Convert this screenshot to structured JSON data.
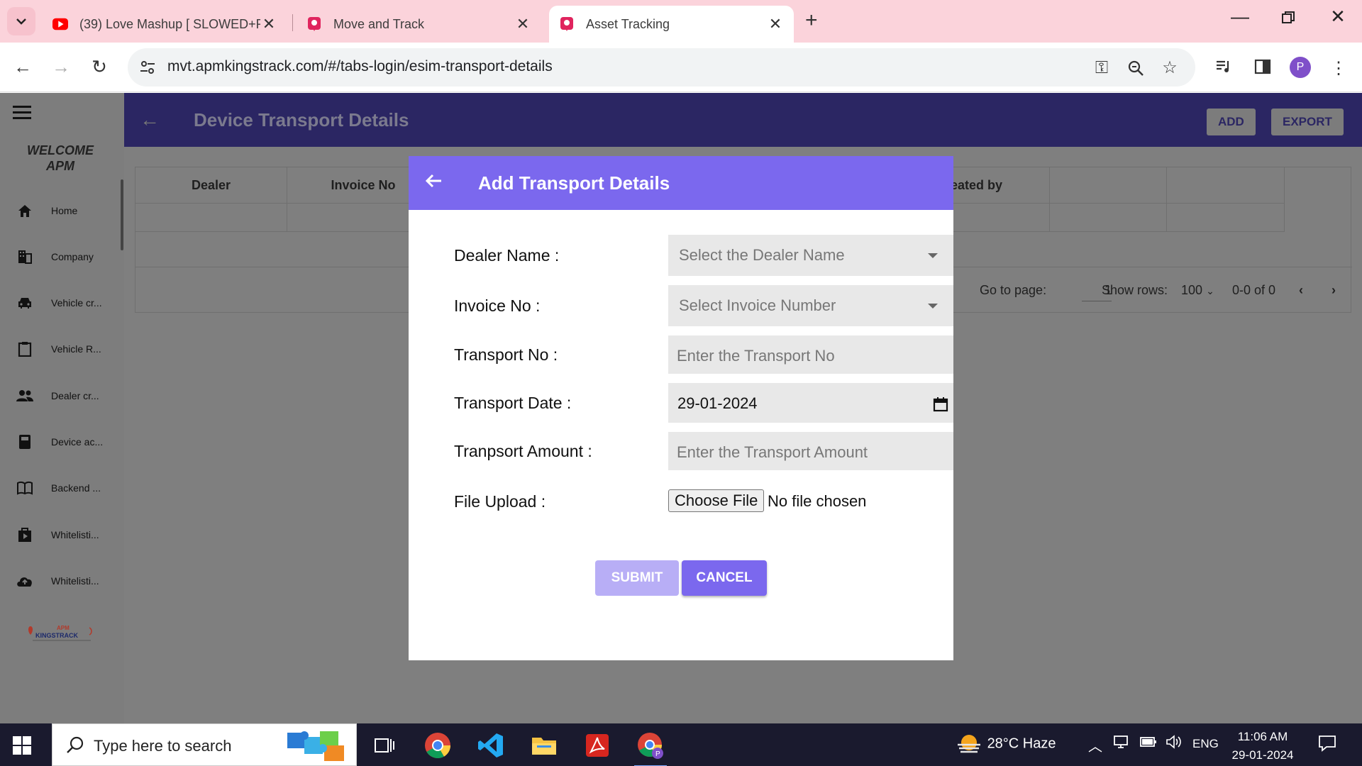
{
  "browser": {
    "tabs": [
      {
        "title": "(39) Love Mashup [ SLOWED+R",
        "icon": "youtube-icon"
      },
      {
        "title": "Move and Track",
        "icon": "map-pin-icon"
      },
      {
        "title": "Asset Tracking",
        "icon": "map-pin-icon"
      }
    ],
    "url": "mvt.apmkingstrack.com/#/tabs-login/esim-transport-details",
    "profile_initial": "P"
  },
  "sidebar": {
    "welcome_line1": "WELCOME",
    "welcome_line2": "APM",
    "items": [
      {
        "label": "Home",
        "icon": "home-icon"
      },
      {
        "label": "Company",
        "icon": "building-icon"
      },
      {
        "label": "Vehicle cr...",
        "icon": "car-icon"
      },
      {
        "label": "Vehicle R...",
        "icon": "clipboard-icon"
      },
      {
        "label": "Dealer cr...",
        "icon": "people-icon"
      },
      {
        "label": "Device ac...",
        "icon": "device-icon"
      },
      {
        "label": "Backend ...",
        "icon": "book-icon"
      },
      {
        "label": "Whitelisti...",
        "icon": "play-bag-icon"
      },
      {
        "label": "Whitelisti...",
        "icon": "cloud-upload-icon"
      }
    ],
    "logo_text": "APM KINGSTRACK"
  },
  "page": {
    "title": "Device Transport Details",
    "add_label": "ADD",
    "export_label": "EXPORT",
    "columns": [
      "Dealer",
      "Invoice No",
      "",
      "",
      "",
      "",
      "eated by",
      "",
      ""
    ],
    "pager": {
      "goto_label": "Go to page:",
      "goto_value": "1",
      "rows_label": "Show rows:",
      "rows_value": "100",
      "range": "0-0 of 0"
    }
  },
  "modal": {
    "title": "Add Transport Details",
    "fields": {
      "dealer": {
        "label": "Dealer Name :",
        "placeholder": "Select the Dealer Name"
      },
      "invoice": {
        "label": "Invoice No :",
        "placeholder": "Select Invoice Number"
      },
      "transport_no": {
        "label": "Transport No :",
        "placeholder": "Enter the Transport No"
      },
      "transport_date": {
        "label": "Transport Date :",
        "value": "29-01-2024"
      },
      "amount": {
        "label": "Tranpsort Amount :",
        "placeholder": "Enter the Transport Amount"
      },
      "file": {
        "label": "File Upload :",
        "button": "Choose File",
        "status": "No file chosen"
      }
    },
    "submit_label": "SUBMIT",
    "cancel_label": "CANCEL"
  },
  "taskbar": {
    "search_placeholder": "Type here to search",
    "weather": "28°C  Haze",
    "language": "ENG",
    "time": "11:06 AM",
    "date": "29-01-2024"
  }
}
